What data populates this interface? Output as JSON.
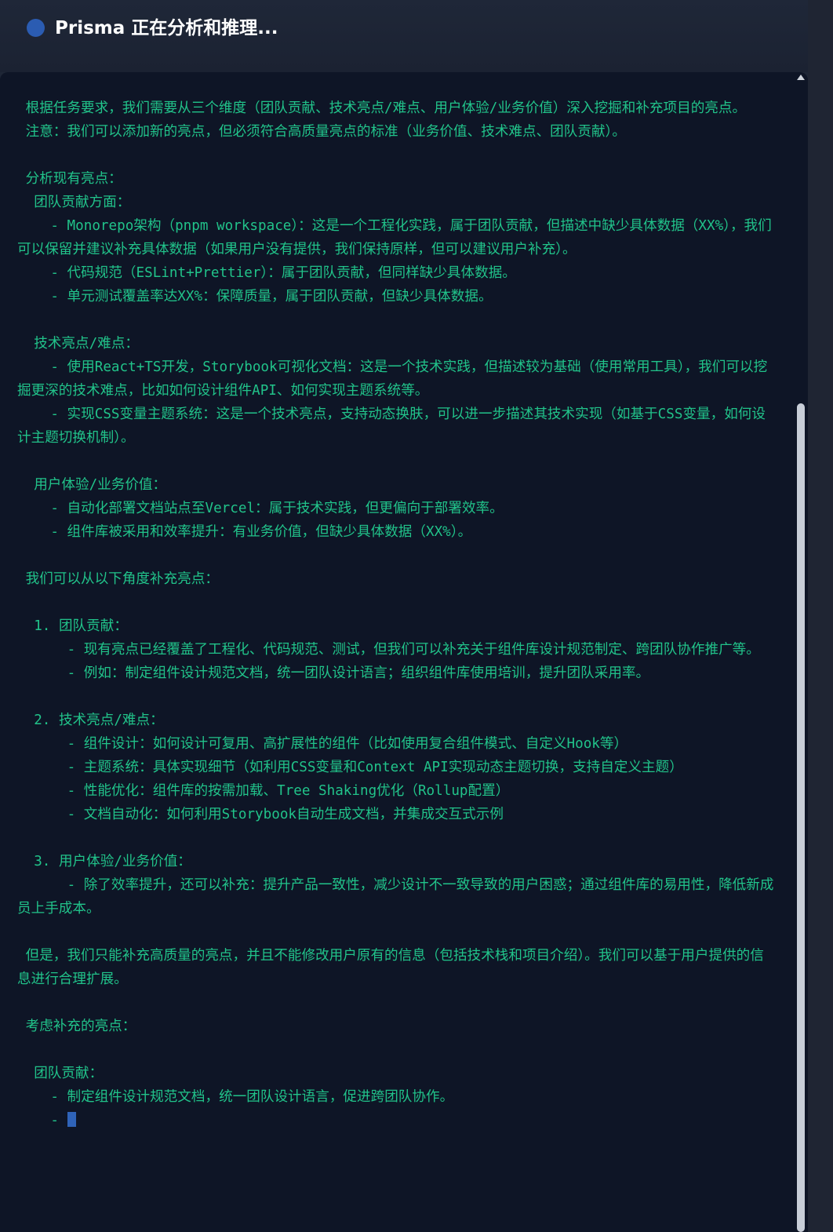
{
  "header": {
    "title": "Prisma 正在分析和推理..."
  },
  "stream": {
    "text": " 根据任务要求，我们需要从三个维度（团队贡献、技术亮点/难点、用户体验/业务价值）深入挖掘和补充项目的亮点。\n 注意：我们可以添加新的亮点，但必须符合高质量亮点的标准（业务价值、技术难点、团队贡献）。\n\n 分析现有亮点：\n  团队贡献方面：\n    - Monorepo架构（pnpm workspace）：这是一个工程化实践，属于团队贡献，但描述中缺少具体数据（XX%），我们可以保留并建议补充具体数据（如果用户没有提供，我们保持原样，但可以建议用户补充）。\n    - 代码规范（ESLint+Prettier）：属于团队贡献，但同样缺少具体数据。\n    - 单元测试覆盖率达XX%：保障质量，属于团队贡献，但缺少具体数据。\n\n  技术亮点/难点：\n    - 使用React+TS开发，Storybook可视化文档：这是一个技术实践，但描述较为基础（使用常用工具），我们可以挖掘更深的技术难点，比如如何设计组件API、如何实现主题系统等。\n    - 实现CSS变量主题系统：这是一个技术亮点，支持动态换肤，可以进一步描述其技术实现（如基于CSS变量，如何设计主题切换机制）。\n\n  用户体验/业务价值：\n    - 自动化部署文档站点至Vercel：属于技术实践，但更偏向于部署效率。\n    - 组件库被采用和效率提升：有业务价值，但缺少具体数据（XX%）。\n\n 我们可以从以下角度补充亮点：\n\n  1. 团队贡献：\n      - 现有亮点已经覆盖了工程化、代码规范、测试，但我们可以补充关于组件库设计规范制定、跨团队协作推广等。\n      - 例如：制定组件设计规范文档，统一团队设计语言；组织组件库使用培训，提升团队采用率。\n\n  2. 技术亮点/难点：\n      - 组件设计：如何设计可复用、高扩展性的组件（比如使用复合组件模式、自定义Hook等）\n      - 主题系统：具体实现细节（如利用CSS变量和Context API实现动态主题切换，支持自定义主题）\n      - 性能优化：组件库的按需加载、Tree Shaking优化（Rollup配置）\n      - 文档自动化：如何利用Storybook自动生成文档，并集成交互式示例\n\n  3. 用户体验/业务价值：\n      - 除了效率提升，还可以补充：提升产品一致性，减少设计不一致导致的用户困惑；通过组件库的易用性，降低新成员上手成本。\n\n 但是，我们只能补充高质量的亮点，并且不能修改用户原有的信息（包括技术栈和项目介绍）。我们可以基于用户提供的信息进行合理扩展。\n\n 考虑补充的亮点：\n\n  团队贡献：\n    - 制定组件设计规范文档，统一团队设计语言，促进跨团队协作。\n    - "
  },
  "colors": {
    "text": "#21c38a",
    "panel_background": "#0e1526",
    "header_background": "#1e2636",
    "status_dot": "#2b5cb2",
    "caret": "#2f63b8"
  },
  "icons": {
    "status": "status-dot-icon",
    "scroll_up": "scroll-up-arrow-icon",
    "cursor": "typing-cursor-icon"
  }
}
